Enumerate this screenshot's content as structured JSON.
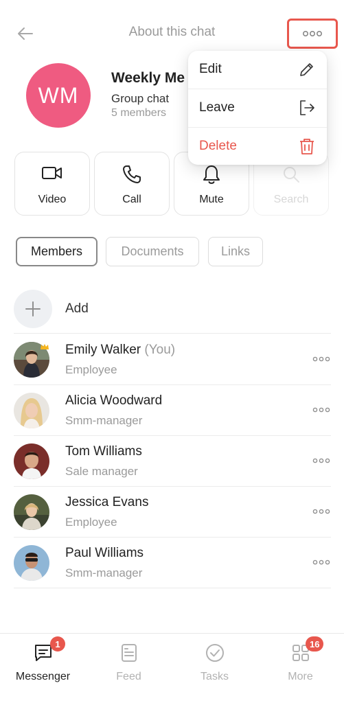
{
  "header": {
    "title": "About this chat",
    "back_icon": "arrow-left-icon",
    "more_icon": "ellipsis-icon"
  },
  "chat": {
    "initials": "WM",
    "name": "Weekly Me",
    "type": "Group chat",
    "members_count": "5 members",
    "avatar_color": "#ef5b81"
  },
  "actions": [
    {
      "label": "Video",
      "icon": "video-camera-icon"
    },
    {
      "label": "Call",
      "icon": "phone-icon"
    },
    {
      "label": "Mute",
      "icon": "bell-icon"
    },
    {
      "label": "Search",
      "icon": "search-icon"
    }
  ],
  "tabs": [
    {
      "label": "Members",
      "active": true
    },
    {
      "label": "Documents",
      "active": false
    },
    {
      "label": "Links",
      "active": false
    }
  ],
  "add": {
    "label": "Add",
    "icon": "plus-icon"
  },
  "members": [
    {
      "name": "Emily Walker",
      "suffix": "(You)",
      "role": "Employee"
    },
    {
      "name": "Alicia Woodward",
      "suffix": "",
      "role": "Smm-manager"
    },
    {
      "name": "Tom Williams",
      "suffix": "",
      "role": "Sale manager"
    },
    {
      "name": "Jessica Evans",
      "suffix": "",
      "role": "Employee"
    },
    {
      "name": "Paul Williams",
      "suffix": "",
      "role": "Smm-manager"
    }
  ],
  "menu": {
    "items": [
      {
        "label": "Edit",
        "icon": "pencil-icon"
      },
      {
        "label": "Leave",
        "icon": "exit-icon"
      },
      {
        "label": "Delete",
        "icon": "trash-icon"
      }
    ]
  },
  "tabbar": {
    "items": [
      {
        "label": "Messenger",
        "icon": "chat-bubble-icon",
        "badge": "1",
        "active": true
      },
      {
        "label": "Feed",
        "icon": "feed-icon",
        "badge": "",
        "active": false
      },
      {
        "label": "Tasks",
        "icon": "check-circle-icon",
        "badge": "",
        "active": false
      },
      {
        "label": "More",
        "icon": "grid-icon",
        "badge": "16",
        "active": false
      }
    ]
  },
  "colors": {
    "accent": "#e8574d",
    "muted": "#9a9a9a"
  }
}
